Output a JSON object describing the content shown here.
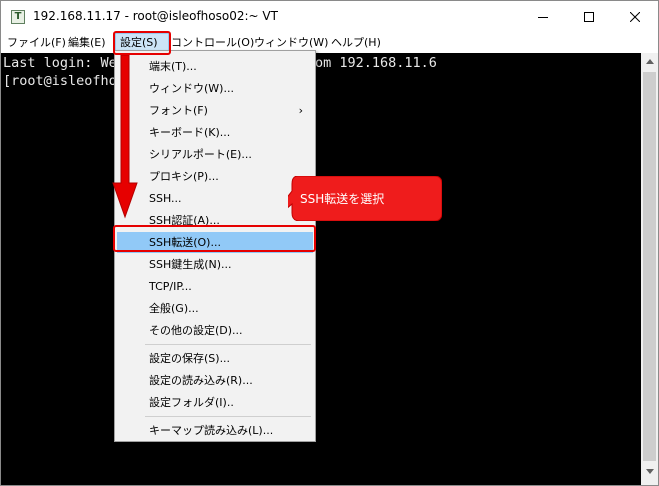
{
  "window": {
    "title": "192.168.11.17 - root@isleofhoso02:~ VT",
    "app_icon_glyph": "T"
  },
  "menubar": {
    "items": [
      {
        "label": "ファイル(F)"
      },
      {
        "label": "編集(E)"
      },
      {
        "label": "設定(S)"
      },
      {
        "label": "コントロール(O)"
      },
      {
        "label": "ウィンドウ(W)"
      },
      {
        "label": "ヘルプ(H)"
      }
    ]
  },
  "terminal": {
    "line1_start": "Last login: We",
    "line1_end": "om 192.168.11.6",
    "line2_start": "[root@isleofho"
  },
  "settings_menu": {
    "items": [
      {
        "label": "端末(T)..."
      },
      {
        "label": "ウィンドウ(W)..."
      },
      {
        "label": "フォント(F)"
      },
      {
        "label": "キーボード(K)..."
      },
      {
        "label": "シリアルポート(E)..."
      },
      {
        "label": "プロキシ(P)..."
      },
      {
        "label": "SSH..."
      },
      {
        "label": "SSH認証(A)..."
      },
      {
        "label": "SSH転送(O)..."
      },
      {
        "label": "SSH鍵生成(N)..."
      },
      {
        "label": "TCP/IP..."
      },
      {
        "label": "全般(G)..."
      },
      {
        "label": "その他の設定(D)..."
      },
      {
        "label": "設定の保存(S)..."
      },
      {
        "label": "設定の読み込み(R)..."
      },
      {
        "label": "設定フォルダ(I).."
      },
      {
        "label": "キーマップ読み込み(L)..."
      }
    ],
    "submenu_arrow": "›"
  },
  "annotation": {
    "callout_text": "SSH転送を選択",
    "color": "#e60000"
  }
}
